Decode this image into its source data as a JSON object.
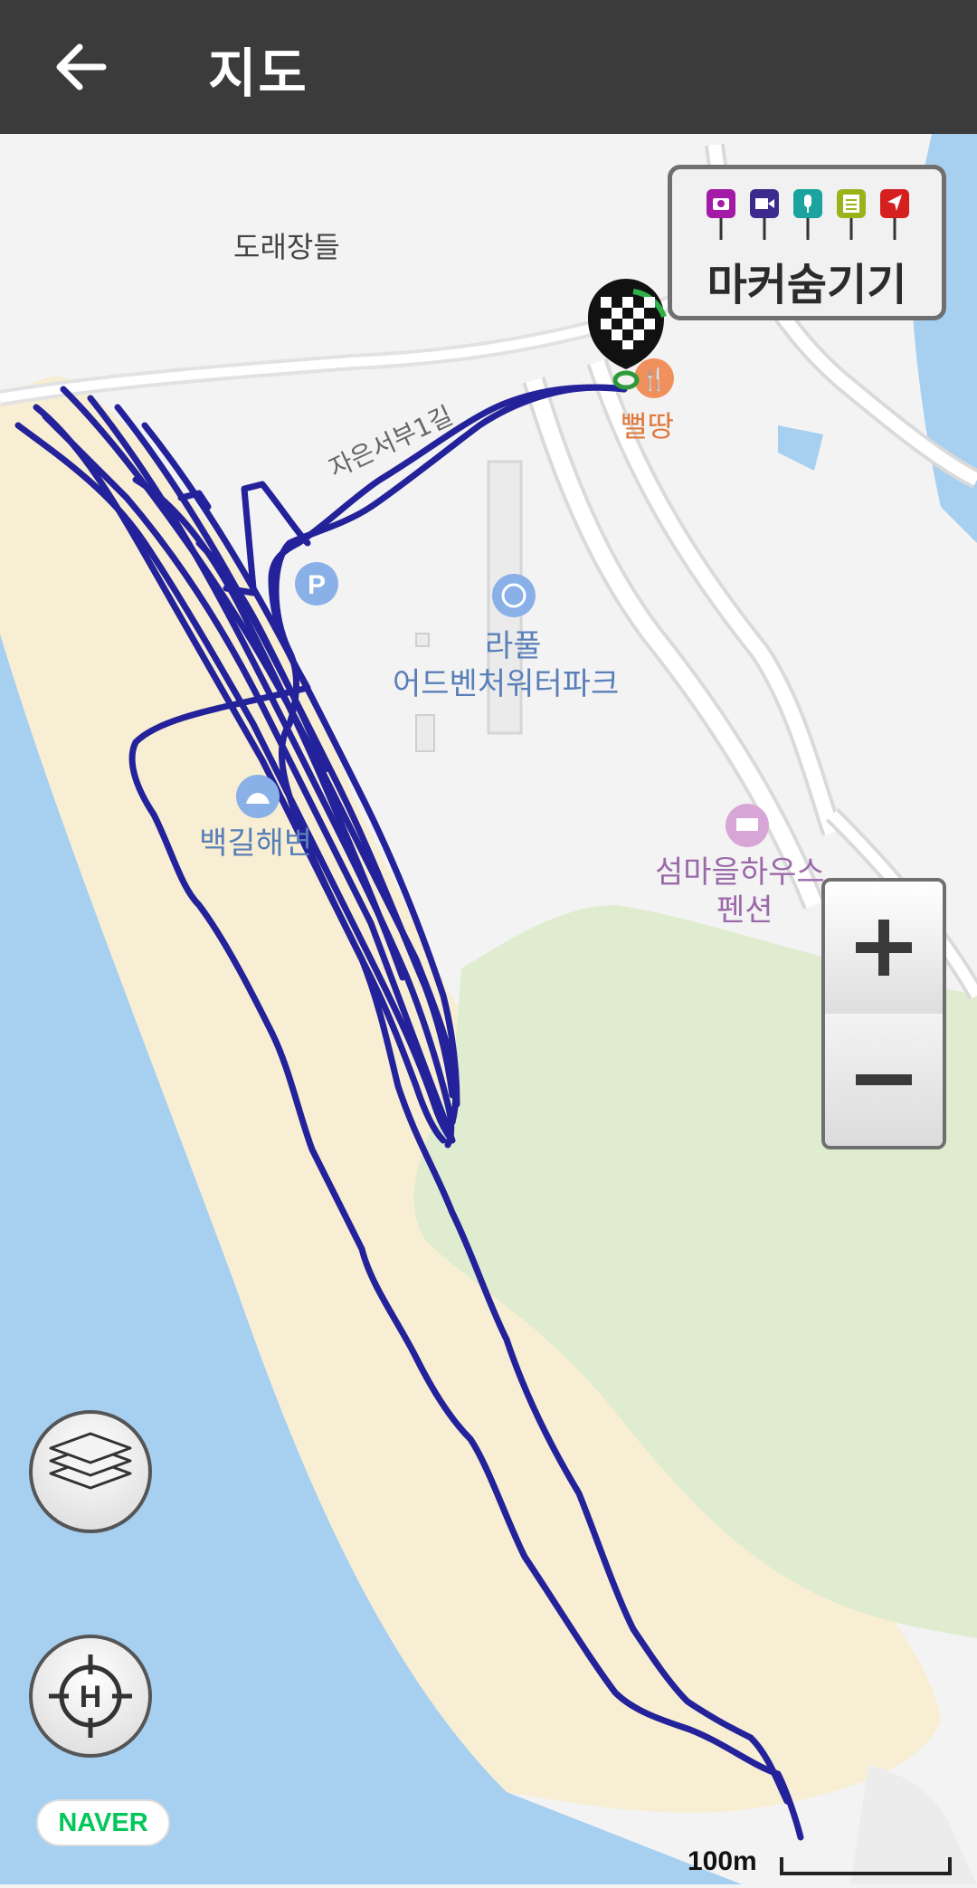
{
  "appbar": {
    "title": "지도",
    "back_icon": "arrow-left-icon"
  },
  "map": {
    "labels": {
      "place_doraejangdeul": "도래장들",
      "restaurant": "뻘땅",
      "road": "자은서부1길",
      "waterpark_line1": "라풀",
      "waterpark_line2": "어드벤처워터파크",
      "beach": "백길해변",
      "pension_line1": "섬마을하우스",
      "pension_line2": "펜션"
    },
    "colors": {
      "sea": "#a6cff0",
      "sand": "#f8eed3",
      "forest": "#dfeccf",
      "track": "#23229a",
      "land": "#f3f3f3"
    }
  },
  "marker_toggle": {
    "label": "마커숨기기",
    "icons": [
      "camera-icon",
      "video-icon",
      "microphone-icon",
      "memo-icon",
      "flag-icon"
    ],
    "icon_colors": [
      "#a21aa6",
      "#3c2a8c",
      "#1aa39f",
      "#9bb21a",
      "#d61f1f"
    ]
  },
  "zoom": {
    "in_icon": "plus-icon",
    "out_icon": "minus-icon"
  },
  "controls": {
    "layers_icon": "layers-icon",
    "home_icon": "home-target-icon"
  },
  "footer": {
    "provider": "NAVER",
    "scale_label": "100m"
  }
}
